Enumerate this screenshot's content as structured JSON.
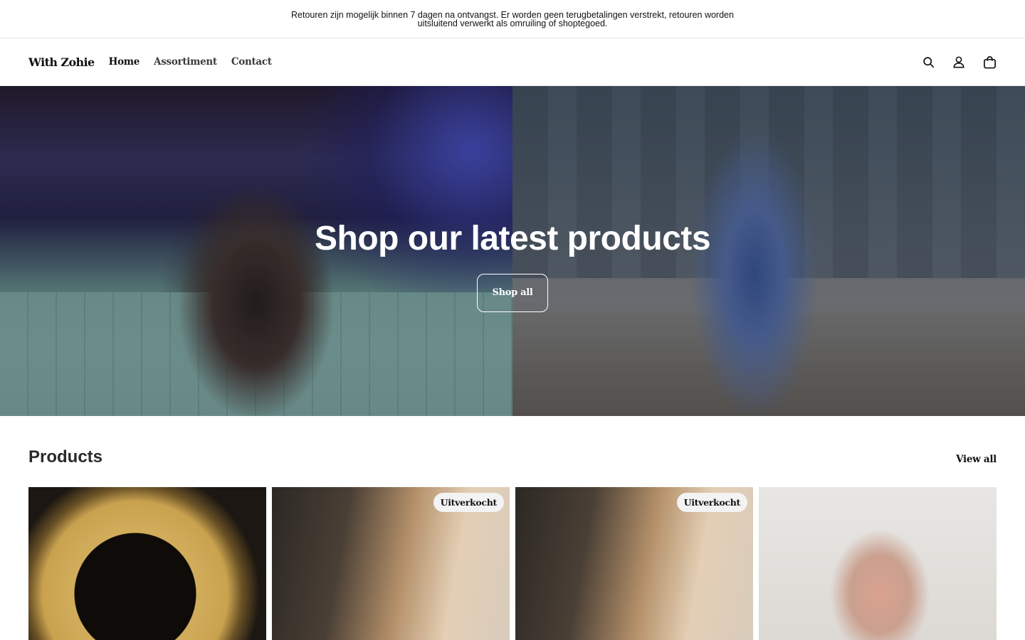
{
  "announcement": {
    "text": "Retouren zijn mogelijk binnen 7 dagen na ontvangst. Er worden geen terugbetalingen verstrekt, retouren worden uitsluitend verwerkt als omruiling of shoptegoed."
  },
  "header": {
    "logo": "With Zohie",
    "nav": [
      "Home",
      "Assortiment",
      "Contact"
    ],
    "icons": [
      "search-icon",
      "account-icon",
      "cart-icon"
    ]
  },
  "hero": {
    "title": "Shop our latest products",
    "button_label": "Shop all"
  },
  "products": {
    "title": "Products",
    "view_all": "View all",
    "items": [
      {
        "badge": ""
      },
      {
        "badge": "Uitverkocht"
      },
      {
        "badge": "Uitverkocht"
      },
      {
        "badge": ""
      }
    ]
  }
}
